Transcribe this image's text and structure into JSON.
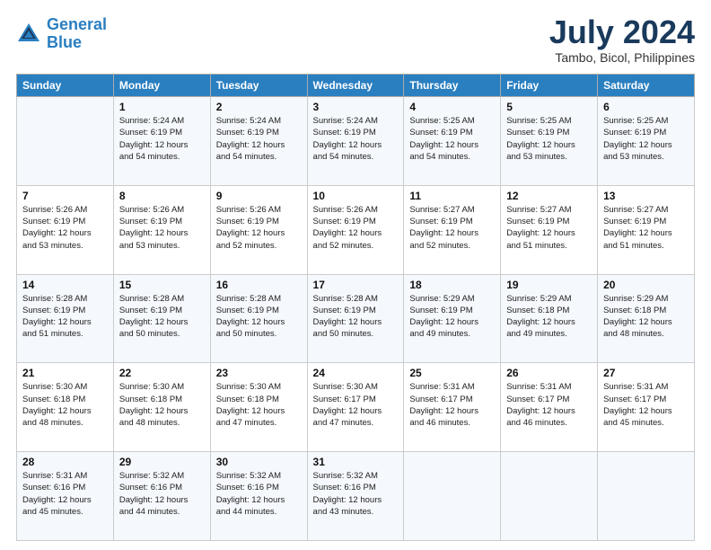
{
  "header": {
    "logo_line1": "General",
    "logo_line2": "Blue",
    "title": "July 2024",
    "subtitle": "Tambo, Bicol, Philippines"
  },
  "days_of_week": [
    "Sunday",
    "Monday",
    "Tuesday",
    "Wednesday",
    "Thursday",
    "Friday",
    "Saturday"
  ],
  "weeks": [
    [
      {
        "day": "",
        "info": ""
      },
      {
        "day": "1",
        "info": "Sunrise: 5:24 AM\nSunset: 6:19 PM\nDaylight: 12 hours\nand 54 minutes."
      },
      {
        "day": "2",
        "info": "Sunrise: 5:24 AM\nSunset: 6:19 PM\nDaylight: 12 hours\nand 54 minutes."
      },
      {
        "day": "3",
        "info": "Sunrise: 5:24 AM\nSunset: 6:19 PM\nDaylight: 12 hours\nand 54 minutes."
      },
      {
        "day": "4",
        "info": "Sunrise: 5:25 AM\nSunset: 6:19 PM\nDaylight: 12 hours\nand 54 minutes."
      },
      {
        "day": "5",
        "info": "Sunrise: 5:25 AM\nSunset: 6:19 PM\nDaylight: 12 hours\nand 53 minutes."
      },
      {
        "day": "6",
        "info": "Sunrise: 5:25 AM\nSunset: 6:19 PM\nDaylight: 12 hours\nand 53 minutes."
      }
    ],
    [
      {
        "day": "7",
        "info": "Sunrise: 5:26 AM\nSunset: 6:19 PM\nDaylight: 12 hours\nand 53 minutes."
      },
      {
        "day": "8",
        "info": "Sunrise: 5:26 AM\nSunset: 6:19 PM\nDaylight: 12 hours\nand 53 minutes."
      },
      {
        "day": "9",
        "info": "Sunrise: 5:26 AM\nSunset: 6:19 PM\nDaylight: 12 hours\nand 52 minutes."
      },
      {
        "day": "10",
        "info": "Sunrise: 5:26 AM\nSunset: 6:19 PM\nDaylight: 12 hours\nand 52 minutes."
      },
      {
        "day": "11",
        "info": "Sunrise: 5:27 AM\nSunset: 6:19 PM\nDaylight: 12 hours\nand 52 minutes."
      },
      {
        "day": "12",
        "info": "Sunrise: 5:27 AM\nSunset: 6:19 PM\nDaylight: 12 hours\nand 51 minutes."
      },
      {
        "day": "13",
        "info": "Sunrise: 5:27 AM\nSunset: 6:19 PM\nDaylight: 12 hours\nand 51 minutes."
      }
    ],
    [
      {
        "day": "14",
        "info": "Sunrise: 5:28 AM\nSunset: 6:19 PM\nDaylight: 12 hours\nand 51 minutes."
      },
      {
        "day": "15",
        "info": "Sunrise: 5:28 AM\nSunset: 6:19 PM\nDaylight: 12 hours\nand 50 minutes."
      },
      {
        "day": "16",
        "info": "Sunrise: 5:28 AM\nSunset: 6:19 PM\nDaylight: 12 hours\nand 50 minutes."
      },
      {
        "day": "17",
        "info": "Sunrise: 5:28 AM\nSunset: 6:19 PM\nDaylight: 12 hours\nand 50 minutes."
      },
      {
        "day": "18",
        "info": "Sunrise: 5:29 AM\nSunset: 6:19 PM\nDaylight: 12 hours\nand 49 minutes."
      },
      {
        "day": "19",
        "info": "Sunrise: 5:29 AM\nSunset: 6:18 PM\nDaylight: 12 hours\nand 49 minutes."
      },
      {
        "day": "20",
        "info": "Sunrise: 5:29 AM\nSunset: 6:18 PM\nDaylight: 12 hours\nand 48 minutes."
      }
    ],
    [
      {
        "day": "21",
        "info": "Sunrise: 5:30 AM\nSunset: 6:18 PM\nDaylight: 12 hours\nand 48 minutes."
      },
      {
        "day": "22",
        "info": "Sunrise: 5:30 AM\nSunset: 6:18 PM\nDaylight: 12 hours\nand 48 minutes."
      },
      {
        "day": "23",
        "info": "Sunrise: 5:30 AM\nSunset: 6:18 PM\nDaylight: 12 hours\nand 47 minutes."
      },
      {
        "day": "24",
        "info": "Sunrise: 5:30 AM\nSunset: 6:17 PM\nDaylight: 12 hours\nand 47 minutes."
      },
      {
        "day": "25",
        "info": "Sunrise: 5:31 AM\nSunset: 6:17 PM\nDaylight: 12 hours\nand 46 minutes."
      },
      {
        "day": "26",
        "info": "Sunrise: 5:31 AM\nSunset: 6:17 PM\nDaylight: 12 hours\nand 46 minutes."
      },
      {
        "day": "27",
        "info": "Sunrise: 5:31 AM\nSunset: 6:17 PM\nDaylight: 12 hours\nand 45 minutes."
      }
    ],
    [
      {
        "day": "28",
        "info": "Sunrise: 5:31 AM\nSunset: 6:16 PM\nDaylight: 12 hours\nand 45 minutes."
      },
      {
        "day": "29",
        "info": "Sunrise: 5:32 AM\nSunset: 6:16 PM\nDaylight: 12 hours\nand 44 minutes."
      },
      {
        "day": "30",
        "info": "Sunrise: 5:32 AM\nSunset: 6:16 PM\nDaylight: 12 hours\nand 44 minutes."
      },
      {
        "day": "31",
        "info": "Sunrise: 5:32 AM\nSunset: 6:16 PM\nDaylight: 12 hours\nand 43 minutes."
      },
      {
        "day": "",
        "info": ""
      },
      {
        "day": "",
        "info": ""
      },
      {
        "day": "",
        "info": ""
      }
    ]
  ]
}
